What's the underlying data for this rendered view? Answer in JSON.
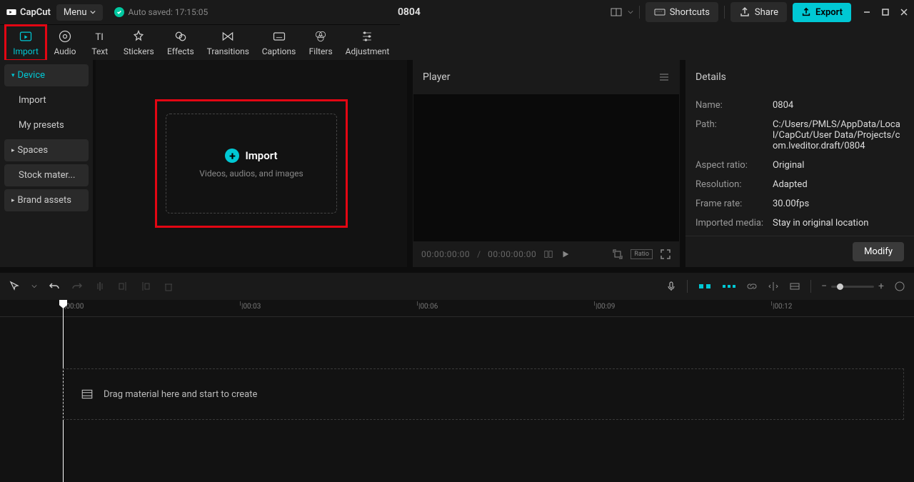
{
  "titlebar": {
    "app_name": "CapCut",
    "menu_label": "Menu",
    "autosave_label": "Auto saved: 17:15:05",
    "project_title": "0804",
    "shortcuts_label": "Shortcuts",
    "share_label": "Share",
    "export_label": "Export"
  },
  "tabs": {
    "import": "Import",
    "audio": "Audio",
    "text": "Text",
    "stickers": "Stickers",
    "effects": "Effects",
    "transitions": "Transitions",
    "captions": "Captions",
    "filters": "Filters",
    "adjustment": "Adjustment"
  },
  "sidebar": {
    "device": "Device",
    "import": "Import",
    "mypresets": "My presets",
    "spaces": "Spaces",
    "stock": "Stock mater...",
    "brand": "Brand assets"
  },
  "import_zone": {
    "title": "Import",
    "subtitle": "Videos, audios, and images"
  },
  "player": {
    "title": "Player",
    "time_current": "00:00:00:00",
    "time_total": "00:00:00:00",
    "ratio": "Ratio"
  },
  "details": {
    "title": "Details",
    "rows": [
      {
        "label": "Name:",
        "value": "0804"
      },
      {
        "label": "Path:",
        "value": "C:/Users/PMLS/AppData/Local/CapCut/User Data/Projects/com.lveditor.draft/0804"
      },
      {
        "label": "Aspect ratio:",
        "value": "Original"
      },
      {
        "label": "Resolution:",
        "value": "Adapted"
      },
      {
        "label": "Frame rate:",
        "value": "30.00fps"
      },
      {
        "label": "Imported media:",
        "value": "Stay in original location"
      }
    ],
    "modify": "Modify"
  },
  "timeline": {
    "ticks": [
      "|00:00",
      "|00:03",
      "|00:06",
      "|00:09",
      "|00:12"
    ],
    "placeholder": "Drag material here and start to create"
  }
}
